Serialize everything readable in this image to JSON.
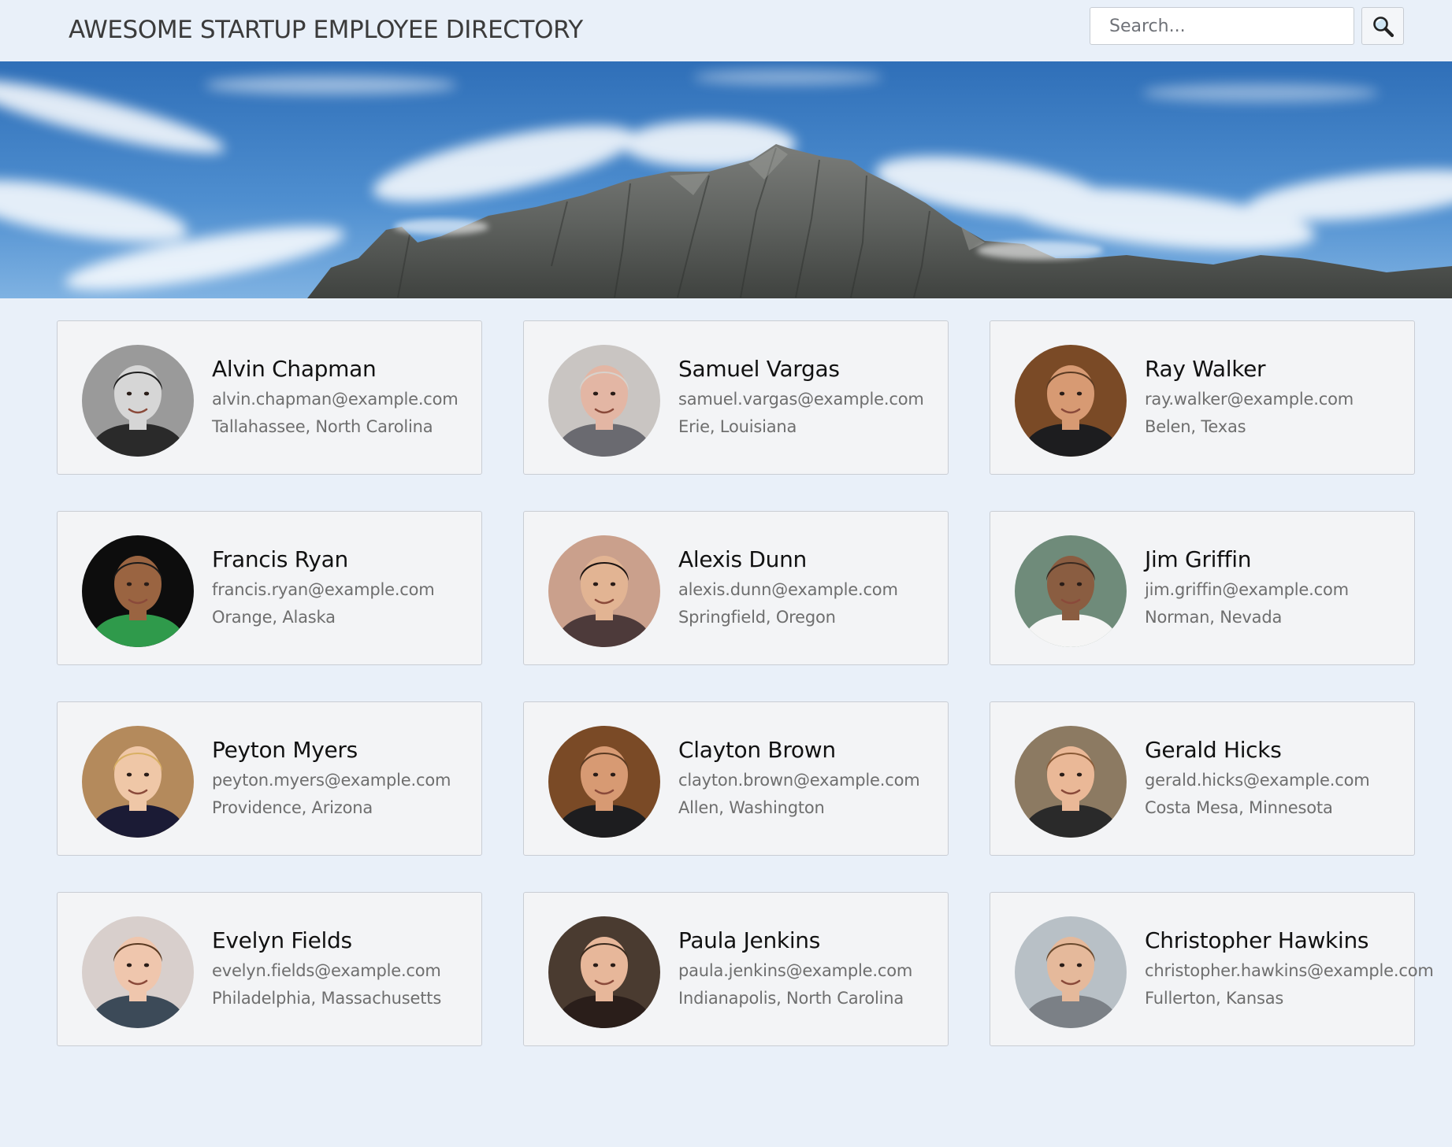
{
  "header": {
    "title": "AWESOME STARTUP EMPLOYEE DIRECTORY",
    "search_placeholder": "Search...",
    "search_icon": "magnifying-glass-icon"
  },
  "banner": {
    "image": "mountain-sky-banner"
  },
  "employees": [
    {
      "name": "Alvin Chapman",
      "email": "alvin.chapman@example.com",
      "location": "Tallahassee, North Carolina",
      "photo": {
        "bg": "#9a9a9a",
        "skin": "#d6d6d6",
        "hair": "#1e1e1e",
        "shirt": "#2a2a2a"
      }
    },
    {
      "name": "Samuel Vargas",
      "email": "samuel.vargas@example.com",
      "location": "Erie, Louisiana",
      "photo": {
        "bg": "#c9c5c2",
        "skin": "#e3b6a4",
        "hair": "#d8d2cc",
        "shirt": "#6a6a70"
      }
    },
    {
      "name": "Ray Walker",
      "email": "ray.walker@example.com",
      "location": "Belen, Texas",
      "photo": {
        "bg": "#7a4a26",
        "skin": "#d79a73",
        "hair": "#5a3a22",
        "shirt": "#1d1d1f"
      }
    },
    {
      "name": "Francis Ryan",
      "email": "francis.ryan@example.com",
      "location": "Orange, Alaska",
      "photo": {
        "bg": "#0d0d0d",
        "skin": "#9a6441",
        "hair": "#1a1a1a",
        "shirt": "#2f9a4b"
      }
    },
    {
      "name": "Alexis Dunn",
      "email": "alexis.dunn@example.com",
      "location": "Springfield, Oregon",
      "photo": {
        "bg": "#caa08c",
        "skin": "#e2b493",
        "hair": "#1c1412",
        "shirt": "#4d3a3a"
      }
    },
    {
      "name": "Jim Griffin",
      "email": "jim.griffin@example.com",
      "location": "Norman, Nevada",
      "photo": {
        "bg": "#6f8b7a",
        "skin": "#8a5d41",
        "hair": "#3a2a20",
        "shirt": "#f5f5f5"
      }
    },
    {
      "name": "Peyton Myers",
      "email": "peyton.myers@example.com",
      "location": "Providence, Arizona",
      "photo": {
        "bg": "#b48a5c",
        "skin": "#efc7a7",
        "hair": "#d9b064",
        "shirt": "#1b1b35"
      }
    },
    {
      "name": "Clayton Brown",
      "email": "clayton.brown@example.com",
      "location": "Allen, Washington",
      "photo": {
        "bg": "#7a4a26",
        "skin": "#d79a73",
        "hair": "#5a3a22",
        "shirt": "#1d1d1f"
      }
    },
    {
      "name": "Gerald Hicks",
      "email": "gerald.hicks@example.com",
      "location": "Costa Mesa, Minnesota",
      "photo": {
        "bg": "#8c7a62",
        "skin": "#eab897",
        "hair": "#8a5a36",
        "shirt": "#2a2a2a"
      }
    },
    {
      "name": "Evelyn Fields",
      "email": "evelyn.fields@example.com",
      "location": "Philadelphia, Massachusetts",
      "photo": {
        "bg": "#d8cfcc",
        "skin": "#efc6ad",
        "hair": "#5a3a22",
        "shirt": "#3c4a58"
      }
    },
    {
      "name": "Paula Jenkins",
      "email": "paula.jenkins@example.com",
      "location": "Indianapolis, North Carolina",
      "photo": {
        "bg": "#4a3b30",
        "skin": "#e7b79a",
        "hair": "#3a2a1e",
        "shirt": "#2a1e1a"
      }
    },
    {
      "name": "Christopher Hawkins",
      "email": "christopher.hawkins@example.com",
      "location": "Fullerton, Kansas",
      "photo": {
        "bg": "#b8c0c6",
        "skin": "#e5b99b",
        "hair": "#6a4a2e",
        "shirt": "#7b8086"
      }
    }
  ]
}
